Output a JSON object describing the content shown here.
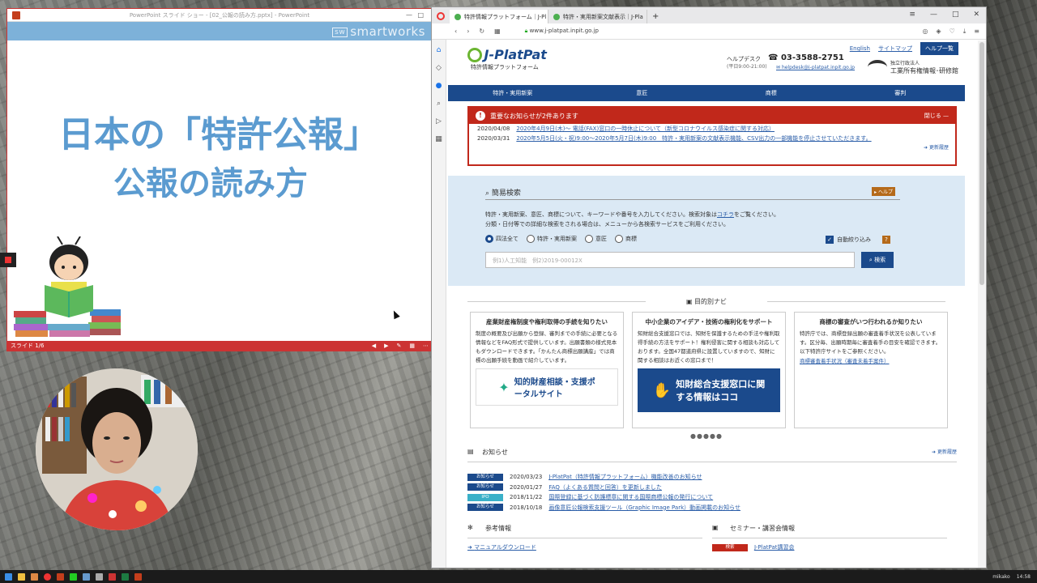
{
  "ppt": {
    "window_title": "PowerPoint スライド ショー - [02_公報の読み方.pptx] - PowerPoint",
    "brand_small": "sw",
    "brand": "smartworks",
    "title_line1": "日本の「特許公報」",
    "title_line2": "公報の読み方",
    "slide_status": "スライド 1/6"
  },
  "browser": {
    "tabs": [
      {
        "label": "特許情報プラットフォーム｜J-Pl"
      },
      {
        "label": "特許・実用新案文献表示｜J-Pla"
      }
    ],
    "new_tab": "+",
    "url": "www.j-platpat.inpit.go.jp"
  },
  "site": {
    "logo": "J-PlatPat",
    "logo_sub": "特許情報プラットフォーム",
    "english": "English",
    "sitemap": "サイトマップ",
    "help_list": "ヘルプ一覧",
    "helpdesk": "ヘルプデスク",
    "helpdesk_hours": "(平日9:00-21:00)",
    "phone": "03-3588-2751",
    "mail": "helpdesk@j-platpat.inpit.go.jp",
    "inpit_sub": "独立行政法人",
    "inpit": "工業所有権情報･研修館",
    "nav": [
      "特許・実用新案",
      "意匠",
      "商標",
      "審判"
    ],
    "notice": {
      "header": "重要なお知らせが2件あります",
      "close": "閉じる —",
      "items": [
        {
          "date": "2020/04/08",
          "text": "2020年4月9日(木)～ 電話(FAX)窓口の一時休止について（新型コロナウイルス感染症に関する対応）"
        },
        {
          "date": "2020/03/31",
          "text": "2020年5月5日(火・祝)9:00～2020年5月7日(木)9:00　特許・実用新案の文献表示機能、CSV出力の一部機能を停止させていただきます。"
        }
      ],
      "history": "更新履歴"
    },
    "search": {
      "title": "簡易検索",
      "help": "▸ ヘルプ",
      "desc1": "特許・実用新案、意匠、商標について、キーワードや番号を入力してください。検索対象は",
      "desc_link": "コチラ",
      "desc1_end": "をご覧ください。",
      "desc2": "分類・日付等での詳細な検索をされる場合は、メニューから各検索サービスをご利用ください。",
      "radios": [
        "四法全て",
        "特許・実用新案",
        "意匠",
        "商標"
      ],
      "auto_narrow": "自動絞り込み",
      "q": "?",
      "placeholder": "例1)人工知能　例2)2019-00012X",
      "button": "検索"
    },
    "navi": {
      "title": "目的別ナビ",
      "cards": [
        {
          "title": "産業財産権制度や権利取得の手続を知りたい",
          "body": "制度の概要及び出願から登録、審判までの手続に必要となる情報などをFAQ形式で提供しています。出願書類の様式見本もダウンロードできます。「かんたん商標出願講座」では商標の出願手続を動画で紹介しています。",
          "banner": "知的財産相談・支援ポータルサイト"
        },
        {
          "title": "中小企業のアイデア・技術の権利化をサポート",
          "body": "知財総合支援窓口では、知財を保護するための手法や権利取得手続の方法をサポート！権利侵害に関する相談も対応しております。全国47都道府県に設置していますので、知財に関する相談はお近くの窓口まで！",
          "banner": "知財総合支援窓口に関する情報はココ"
        },
        {
          "title": "商標の審査がいつ行われるか知りたい",
          "body": "特許庁では、商標登録出願の審査着手状況を公表しています。区分毎、出願時期毎に審査着手の目安を確認できます。以下特許庁サイトをご参照ください。",
          "link": "商標審査着手状況（審査未着手案件）"
        }
      ],
      "dots": "●●●●●"
    },
    "news": {
      "title": "お知らせ",
      "more": "更新履歴",
      "items": [
        {
          "tag": "お知らせ",
          "date": "2020/03/23",
          "text": "J-PlatPat（特許情報プラットフォーム）機能改善のお知らせ"
        },
        {
          "tag": "お知らせ",
          "date": "2020/01/27",
          "text": "FAQ（よくある質問と回答）を更新しました"
        },
        {
          "tag": "IPO",
          "date": "2018/11/22",
          "text": "国際登録に基づく防護標章に関する国際商標公報の発行について"
        },
        {
          "tag": "お知らせ",
          "date": "2018/10/18",
          "text": "画像意匠公報検索支援ツール（Graphic Image Park）動画掲載のお知らせ"
        }
      ]
    },
    "ref": {
      "title": "参考情報",
      "link": "マニュアルダウンロード"
    },
    "seminar": {
      "title": "セミナー・講習会情報",
      "tag": "検索",
      "link": "J-PlatPat講習会"
    }
  },
  "taskbar": {
    "user": "mikako",
    "time": "14:58"
  }
}
